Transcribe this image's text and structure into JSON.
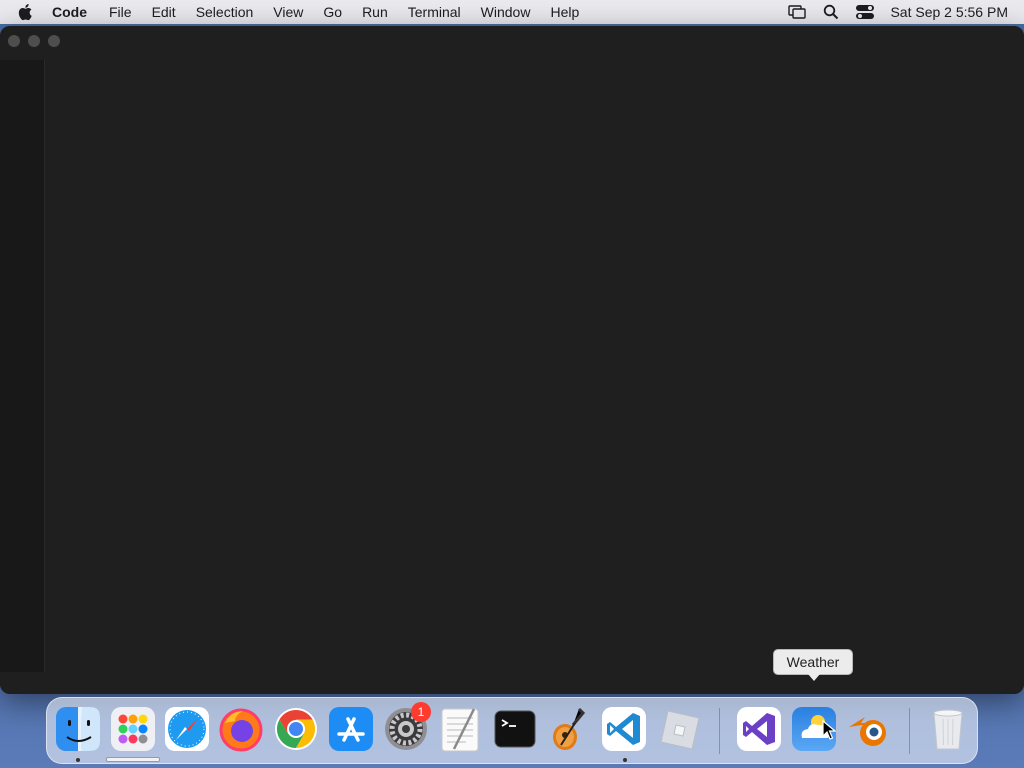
{
  "menubar": {
    "app_name": "Code",
    "items": [
      "File",
      "Edit",
      "Selection",
      "View",
      "Go",
      "Run",
      "Terminal",
      "Window",
      "Help"
    ],
    "clock": "Sat Sep 2  5:56 PM"
  },
  "tooltip": {
    "label": "Weather"
  },
  "dock": {
    "apps": [
      "Finder",
      "Launchpad",
      "Safari",
      "Firefox",
      "Google Chrome",
      "App Store",
      "System Settings",
      "TextEdit",
      "Terminal",
      "GarageBand",
      "Visual Studio Code",
      "Roblox",
      "Visual Studio",
      "Weather",
      "Blender",
      "Trash"
    ],
    "settings_badge": "1"
  }
}
